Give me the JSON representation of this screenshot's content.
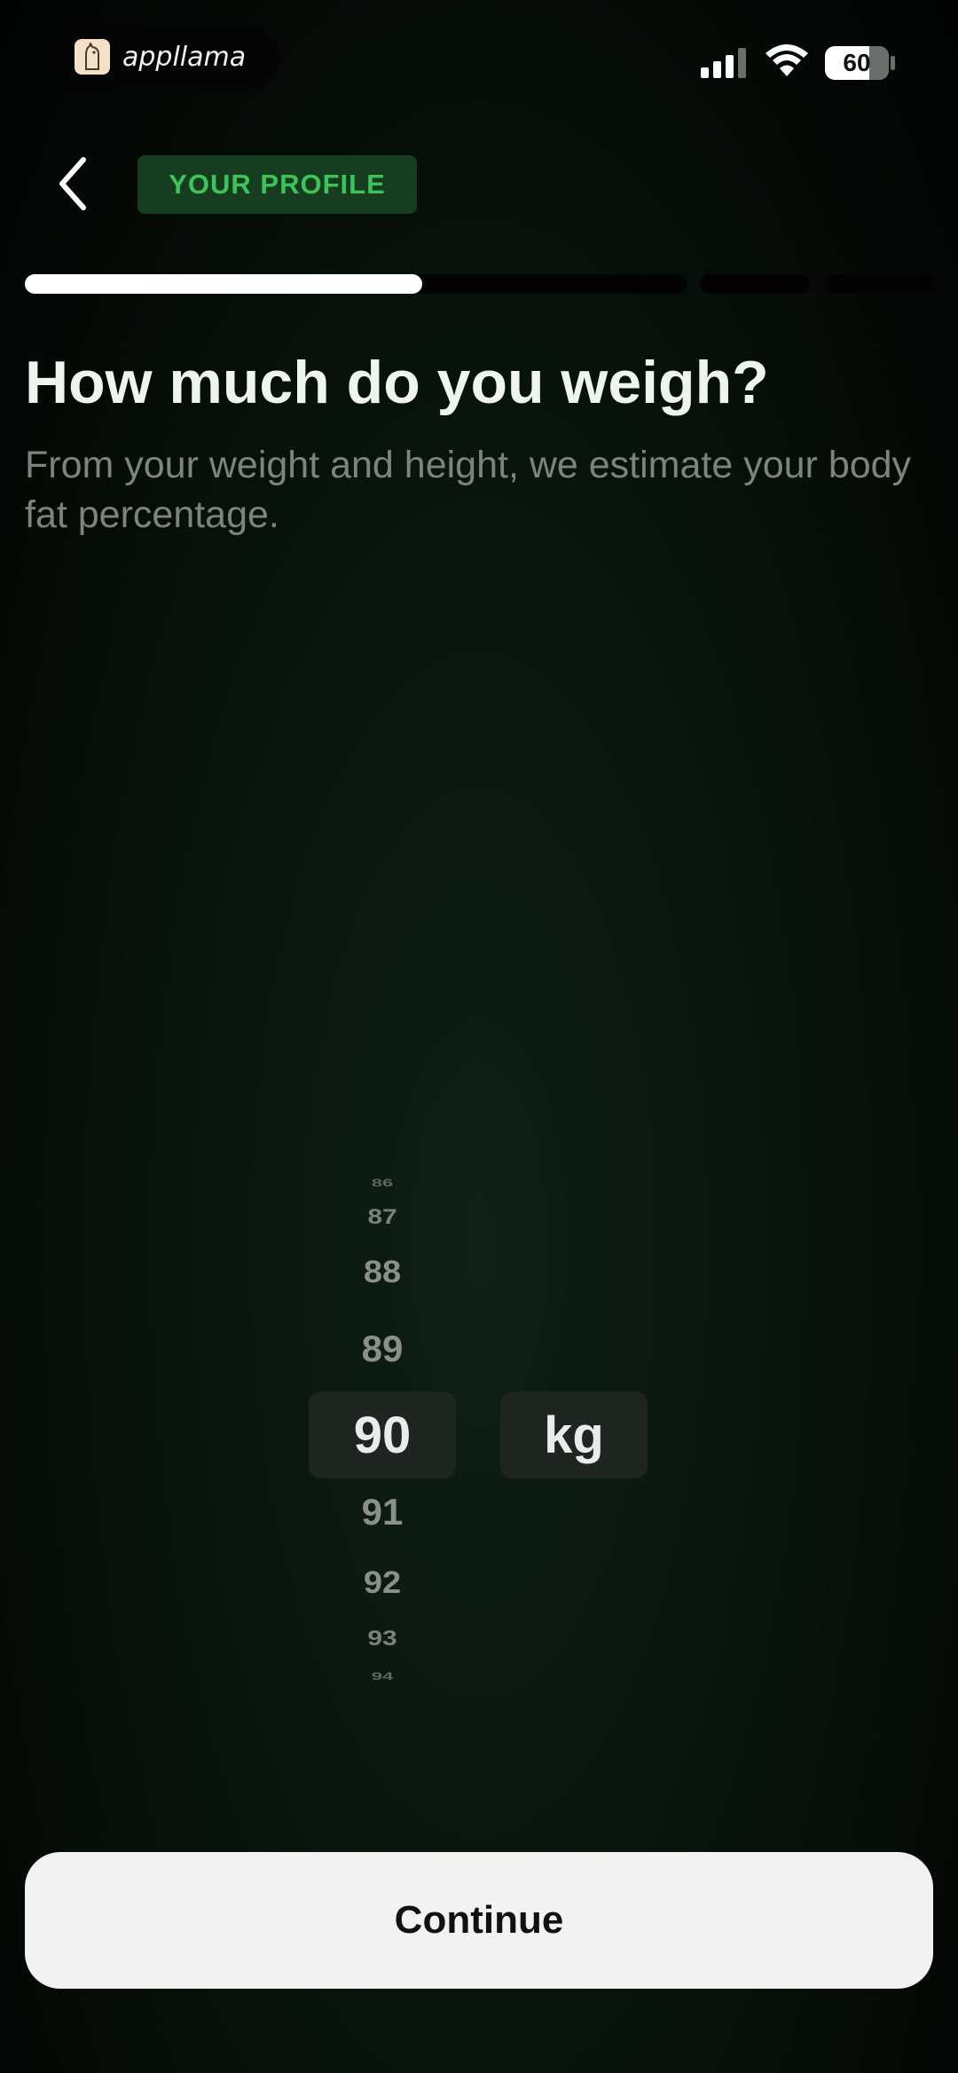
{
  "status_bar": {
    "app_name": "appllama",
    "battery": "60",
    "battery_level": 0.6
  },
  "header": {
    "back_icon": "chevron-left-icon",
    "section_label": "YOUR PROFILE"
  },
  "progress": {
    "segments": 4,
    "current_segment": 1
  },
  "question": {
    "title": "How much do you weigh?",
    "subtitle": "From your weight and height, we estimate your body fat percentage."
  },
  "weight_picker": {
    "values": [
      "86",
      "87",
      "88",
      "89",
      "90",
      "91",
      "92",
      "93",
      "94"
    ],
    "selected": "90",
    "unit": "kg"
  },
  "footer": {
    "continue_label": "Continue"
  },
  "colors": {
    "accent_green": "#3cc35a",
    "badge_bg": "#163d1f",
    "background": "#0a170f"
  }
}
